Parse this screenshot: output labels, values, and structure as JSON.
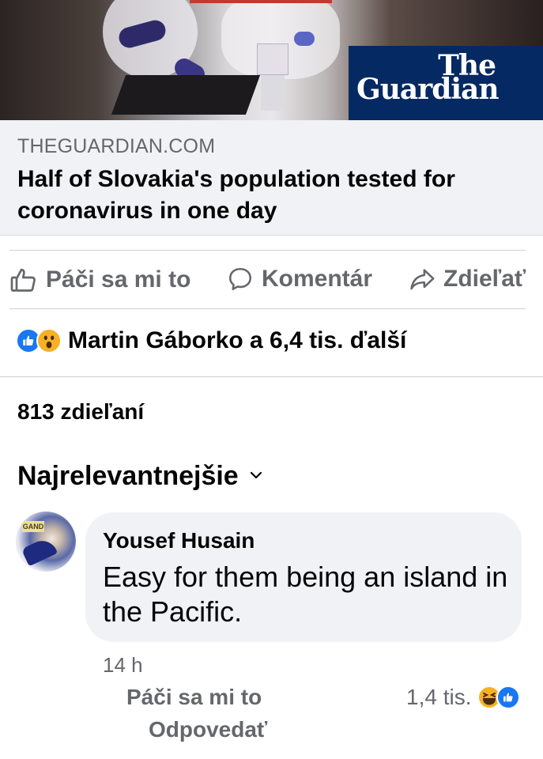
{
  "link_preview": {
    "logo_text_line1": "The",
    "logo_text_line2": "Guardian",
    "domain": "THEGUARDIAN.COM",
    "headline": "Half of Slovakia's population tested for coronavirus in one day"
  },
  "actions": {
    "like_label": "Páči sa mi to",
    "comment_label": "Komentár",
    "share_label": "Zdieľať"
  },
  "reactions": {
    "icons": [
      "like-icon",
      "wow-icon"
    ],
    "summary": "Martin Gáborko a 6,4 tis. ďalší"
  },
  "shares": {
    "text": "813 zdieľaní"
  },
  "sort": {
    "label": "Najrelevantnejšie"
  },
  "comment": {
    "author": "Yousef Husain",
    "text": "Easy for them being an island in the Pacific.",
    "avatar_tag": "GAND",
    "time": "14 h",
    "like_label": "Páči sa mi to",
    "reply_label": "Odpovedať",
    "reaction_count": "1,4 tis.",
    "reaction_icons": [
      "haha-icon",
      "like-icon"
    ]
  },
  "colors": {
    "text_primary": "#050505",
    "text_secondary": "#65676b",
    "card_bg": "#f0f2f5",
    "facebook_blue": "#1877f2",
    "guardian_blue": "#052962",
    "reaction_yellow": "#f7b125"
  }
}
